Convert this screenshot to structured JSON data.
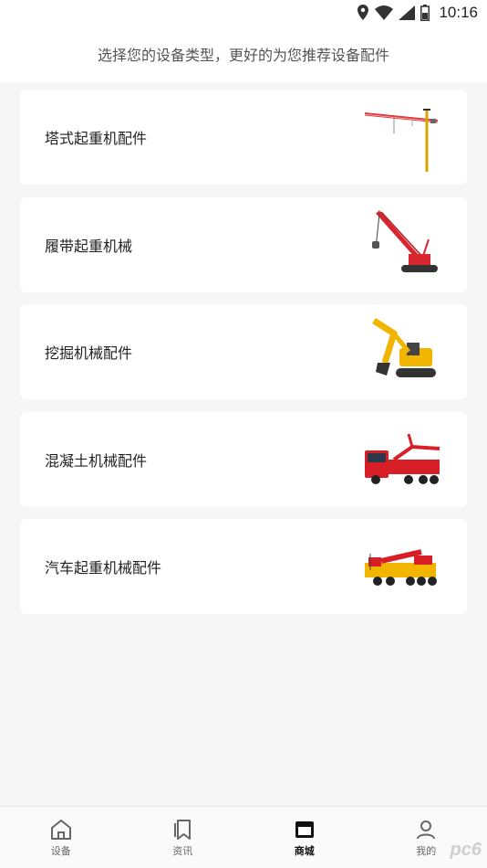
{
  "status_bar": {
    "time": "10:16"
  },
  "header": {
    "subtitle": "选择您的设备类型，更好的为您推荐设备配件"
  },
  "categories": [
    {
      "label": "塔式起重机配件",
      "image": "tower-crane"
    },
    {
      "label": "履带起重机械",
      "image": "crawler-crane"
    },
    {
      "label": "挖掘机械配件",
      "image": "excavator"
    },
    {
      "label": "混凝土机械配件",
      "image": "concrete-pump-truck"
    },
    {
      "label": "汽车起重机械配件",
      "image": "truck-crane"
    }
  ],
  "tabbar": {
    "items": [
      {
        "label": "设备",
        "icon": "home-icon"
      },
      {
        "label": "资讯",
        "icon": "bookmark-icon"
      },
      {
        "label": "商城",
        "icon": "store-icon",
        "active": true
      },
      {
        "label": "我的",
        "icon": "user-icon"
      }
    ]
  },
  "watermark": "pc6"
}
